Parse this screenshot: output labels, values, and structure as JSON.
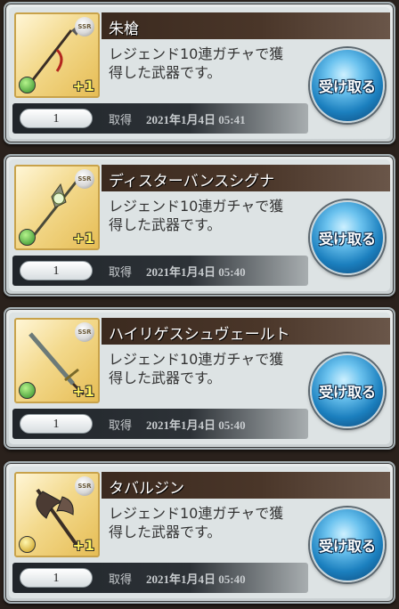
{
  "gifts": [
    {
      "name": "朱槍",
      "description_line1": "レジェンド10連ガチャで獲",
      "description_line2": "得した武器です。",
      "rarity": "SSR",
      "element_icon": "wind-element-icon",
      "plus": "+1",
      "quantity": "1",
      "acquired_label": "取得",
      "acquired_date": "2021年1月4日 05:41",
      "receive_label": "受け取る"
    },
    {
      "name": "ディスターバンスシグナ",
      "description_line1": "レジェンド10連ガチャで獲",
      "description_line2": "得した武器です。",
      "rarity": "SSR",
      "element_icon": "wind-element-icon",
      "plus": "+1",
      "quantity": "1",
      "acquired_label": "取得",
      "acquired_date": "2021年1月4日 05:40",
      "receive_label": "受け取る"
    },
    {
      "name": "ハイリゲスシュヴェールト",
      "description_line1": "レジェンド10連ガチャで獲",
      "description_line2": "得した武器です。",
      "rarity": "SSR",
      "element_icon": "wind-element-icon",
      "plus": "+1",
      "quantity": "1",
      "acquired_label": "取得",
      "acquired_date": "2021年1月4日 05:40",
      "receive_label": "受け取る"
    },
    {
      "name": "タバルジン",
      "description_line1": "レジェンド10連ガチャで獲",
      "description_line2": "得した武器です。",
      "rarity": "SSR",
      "element_icon": "light-element-icon",
      "plus": "+1",
      "quantity": "1",
      "acquired_label": "取得",
      "acquired_date": "2021年1月4日 05:40",
      "receive_label": "受け取る"
    }
  ],
  "colors": {
    "title_bar": "#3b2a1f",
    "button_blue": "#1b7fbe",
    "frame": "#a6b0b4"
  }
}
